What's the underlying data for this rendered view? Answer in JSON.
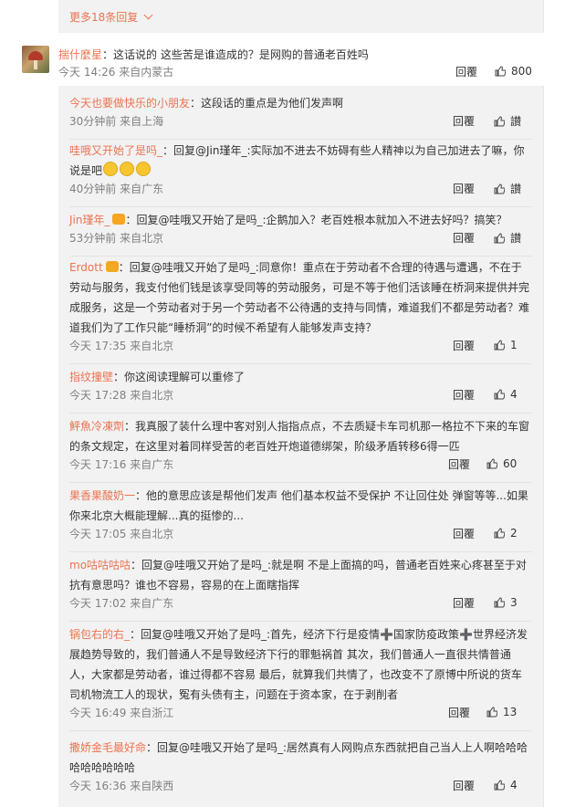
{
  "more_replies": "更多18条回复",
  "main_comment": {
    "author": "揣什麼星",
    "text": "：这话说的 这些苦是谁造成的？是网购的普通老百姓吗",
    "time": "今天 14:26 来自内蒙古",
    "reply": "回覆",
    "likes": "800"
  },
  "replies": [
    {
      "author": "今天也要做快乐的小朋友",
      "text": "：这段话的重点是为他们发声啊",
      "time": "30分钟前 来自上海",
      "reply": "回覆",
      "likes": "讃"
    },
    {
      "author": "哇哦又开始了是吗_",
      "text": "：回复@Jin瑾年_:实际加不进去不妨碍有些人精神以为自己加进去了嘛，你说是吧",
      "time": "40分钟前 来自广东",
      "reply": "回覆",
      "likes": "讃"
    },
    {
      "author": "Jin瑾年_",
      "text": "：回复@哇哦又开始了是吗_:企鹅加入？老百姓根本就加入不进去好吗？搞笑？",
      "time": "53分钟前 来自北京",
      "reply": "回覆",
      "likes": "讃"
    },
    {
      "author": "Erdott",
      "text": "：回复@哇哦又开始了是吗_:同意你！重点在于劳动者不合理的待遇与遭遇，不在于劳动与服务，我支付他们钱是该享受同等的劳动服务，可是不等于他们活该睡在桥洞来提供并完成服务，这是一个劳动者对于另一个劳动者不公待遇的支持与同情，难道我们不都是劳动者？难道我们为了工作只能“睡桥洞”的时候不希望有人能够发声支持？",
      "time": "今天 17:35 来自北京",
      "reply": "回覆",
      "likes": "1"
    },
    {
      "author": "指纹撞壁",
      "text": "：你这阅读理解可以重修了",
      "time": "今天 17:28 来自北京",
      "reply": "回覆",
      "likes": "4"
    },
    {
      "author": "鮃魚冷凍劑",
      "text": "：我真服了装什么理中客对别人指指点点，不去质疑卡车司机那一格拉不下来的车窗的条文规定，在这里对着同样受苦的老百姓开炮道德绑架，阶级矛盾转移6得一匹",
      "time": "今天 17:16 来自广东",
      "reply": "回覆",
      "likes": "60"
    },
    {
      "author": "果香果酸奶一",
      "text": "：他的意思应该是帮他们发声 他们基本权益不受保护 不让回住处 弹窗等等...如果你来北京大概能理解...真的挺惨的...",
      "time": "今天 17:05 来自北京",
      "reply": "回覆",
      "likes": "2"
    },
    {
      "author": "mo咕咕咕咕",
      "text": "：回复@哇哦又开始了是吗_:就是啊 不是上面搞的吗，普通老百姓来心疼甚至于对抗有意思吗？谁也不容易，容易的在上面瞎指挥",
      "time": "今天 17:02 来自广东",
      "reply": "回覆",
      "likes": "3"
    },
    {
      "author": "锅包右的右_",
      "text": "：回复@哇哦又开始了是吗_:首先，经济下行是疫情➕国家防疫政策➕世界经济发展趋势导致的，我们普通人不是导致经济下行的罪魁祸首 其次，我们普通人一直很共情普通人，大家都是劳动者，谁过得都不容易 最后，就算我们共情了，也改变不了原博中所说的货车司机物流工人的现状，冤有头债有主，问题在于资本家，在于剥削者",
      "time": "今天 16:49 来自浙江",
      "reply": "回覆",
      "likes": "13"
    },
    {
      "author": "撒娇金毛最好命",
      "text": "：回复@哇哦又开始了是吗_:居然真有人网购点东西就把自己当人上人啊哈哈哈哈哈哈哈哈哈",
      "time": "今天 16:36 来自陕西",
      "reply": "回覆",
      "likes": "4"
    }
  ],
  "colors": {
    "link": "#eb7350",
    "panel": "#f2f2f2",
    "meta": "#808080"
  }
}
